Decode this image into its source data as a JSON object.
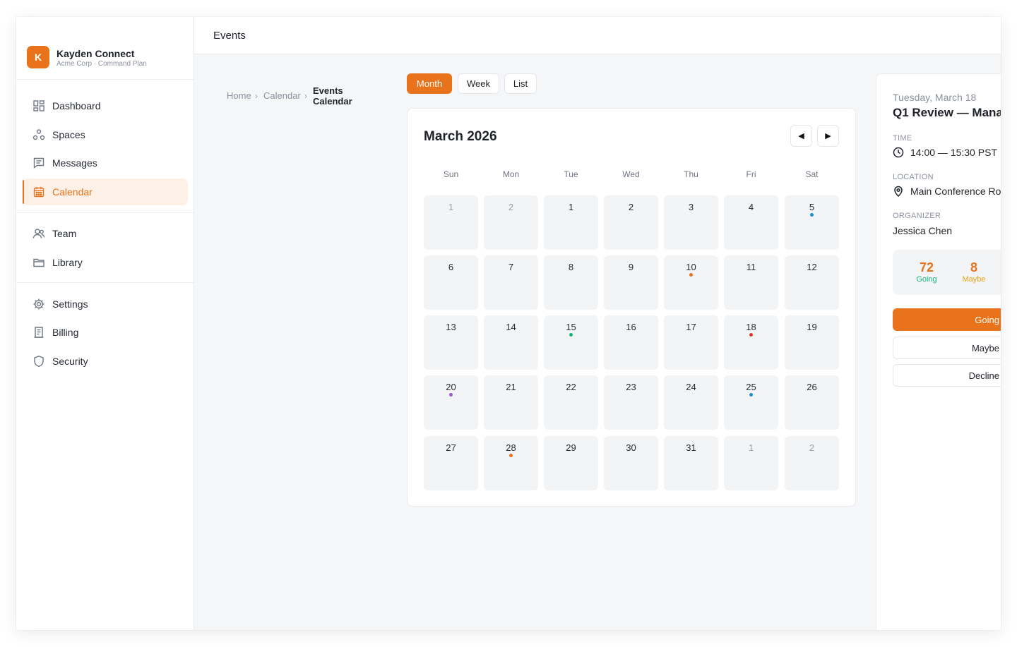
{
  "brand": {
    "initial": "K",
    "name": "Kayden Connect",
    "subtitle": "Acme Corp · Command Plan"
  },
  "sidebar": {
    "items": [
      {
        "label": "Dashboard",
        "icon": "dashboard-icon"
      },
      {
        "label": "Spaces",
        "icon": "spaces-icon"
      },
      {
        "label": "Messages",
        "icon": "messages-icon"
      },
      {
        "label": "Calendar",
        "icon": "calendar-icon",
        "active": true
      },
      {
        "label": "Team",
        "icon": "team-icon"
      },
      {
        "label": "Library",
        "icon": "folder-icon"
      },
      {
        "label": "Settings",
        "icon": "gear-icon"
      },
      {
        "label": "Billing",
        "icon": "receipt-icon"
      },
      {
        "label": "Security",
        "icon": "shield-icon"
      }
    ]
  },
  "header": {
    "title": "Events"
  },
  "breadcrumb": {
    "items": [
      "Home",
      "Calendar"
    ],
    "current_line1": "Events",
    "current_line2": "Calendar"
  },
  "view_tabs": [
    {
      "label": "Month",
      "active": true
    },
    {
      "label": "Week"
    },
    {
      "label": "List"
    }
  ],
  "calendar": {
    "title": "March 2026",
    "prev_icon": "◀",
    "next_icon": "▶",
    "weekdays": [
      "Sun",
      "Mon",
      "Tue",
      "Wed",
      "Thu",
      "Fri",
      "Sat"
    ],
    "days": [
      {
        "n": "1",
        "other": true
      },
      {
        "n": "2",
        "other": true
      },
      {
        "n": "1"
      },
      {
        "n": "2"
      },
      {
        "n": "3"
      },
      {
        "n": "4"
      },
      {
        "n": "5",
        "dot": "#1f8fd1"
      },
      {
        "n": "6"
      },
      {
        "n": "7"
      },
      {
        "n": "8"
      },
      {
        "n": "9"
      },
      {
        "n": "10",
        "dot": "#e8731a"
      },
      {
        "n": "11"
      },
      {
        "n": "12"
      },
      {
        "n": "13"
      },
      {
        "n": "14"
      },
      {
        "n": "15",
        "dot": "#19b37a"
      },
      {
        "n": "16"
      },
      {
        "n": "17"
      },
      {
        "n": "18",
        "dot": "#e0382f"
      },
      {
        "n": "19"
      },
      {
        "n": "20",
        "dot": "#9b59d6"
      },
      {
        "n": "21"
      },
      {
        "n": "22"
      },
      {
        "n": "23"
      },
      {
        "n": "24"
      },
      {
        "n": "25",
        "dot": "#1f8fd1"
      },
      {
        "n": "26"
      },
      {
        "n": "27"
      },
      {
        "n": "28",
        "dot": "#e8731a"
      },
      {
        "n": "29"
      },
      {
        "n": "30"
      },
      {
        "n": "31"
      },
      {
        "n": "1",
        "other": true
      },
      {
        "n": "2",
        "other": true
      }
    ]
  },
  "detail": {
    "date": "Tuesday, March 18",
    "title": "Q1 Review — Mana",
    "time_label": "TIME",
    "time": "14:00 — 15:30 PST",
    "location_label": "LOCATION",
    "location": "Main Conference Ro",
    "organizer_label": "ORGANIZER",
    "organizer": "Jessica Chen",
    "stats": {
      "going_count": "72",
      "going_label": "Going",
      "maybe_count": "8",
      "maybe_label": "Maybe"
    },
    "buttons": {
      "going": "Going",
      "maybe": "Maybe",
      "decline": "Decline"
    }
  },
  "colors": {
    "accent": "#e8731a",
    "going_label": "#19b37a",
    "maybe": "#e8a11a"
  }
}
